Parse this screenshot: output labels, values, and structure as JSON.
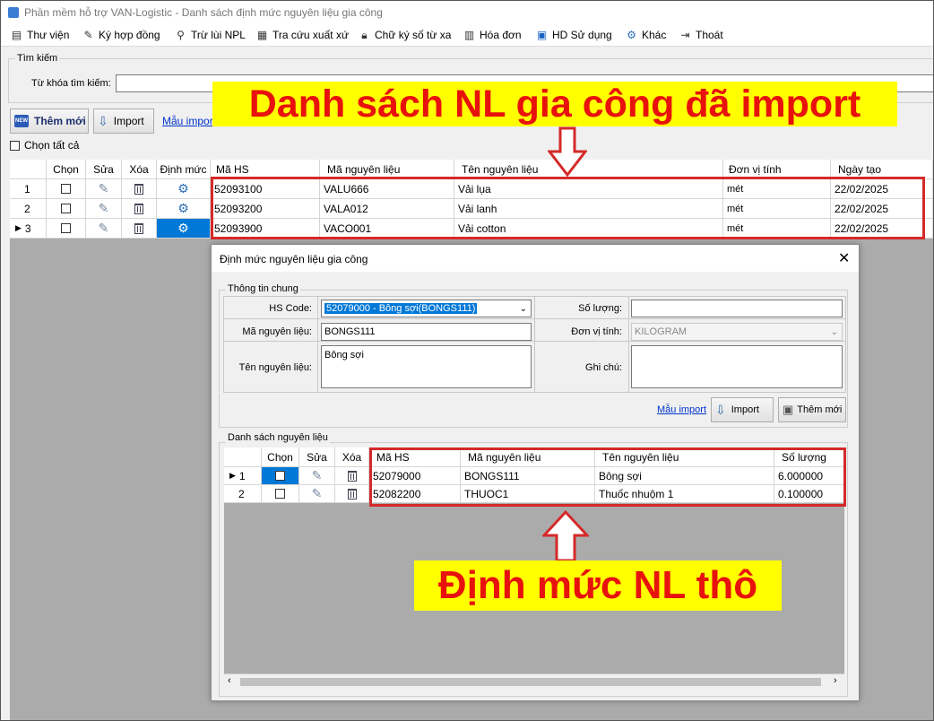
{
  "window": {
    "title": "Phần mềm hỗ trợ VAN-Logistic - Danh sách định mức nguyên liệu gia công"
  },
  "menu": [
    {
      "label": "Thư viện",
      "icon": "library-icon"
    },
    {
      "label": "Ký hợp đồng",
      "icon": "sign-contract-icon"
    },
    {
      "label": "Trừ lùi NPL",
      "icon": "search-deduct-icon"
    },
    {
      "label": "Tra cứu xuất xứ",
      "icon": "origin-lookup-icon"
    },
    {
      "label": "Chữ ký số từ xa",
      "icon": "digital-signature-icon"
    },
    {
      "label": "Hóa đơn",
      "icon": "invoice-icon"
    },
    {
      "label": "HD Sử dụng",
      "icon": "help-icon"
    },
    {
      "label": "Khác",
      "icon": "gear-icon"
    },
    {
      "label": "Thoát",
      "icon": "exit-icon"
    }
  ],
  "search": {
    "group_label": "Tìm kiếm",
    "keyword_label": "Từ khóa tìm kiếm:",
    "keyword_value": ""
  },
  "toolbar": {
    "add_label": "Thêm mới",
    "add_badge": "NEW",
    "import_label": "Import",
    "template_link": "Mẫu import",
    "select_all_label": "Chọn tất cả"
  },
  "main_grid": {
    "columns": [
      "Chọn",
      "Sửa",
      "Xóa",
      "Định mức",
      "Mã HS",
      "Mã nguyên liệu",
      "Tên nguyên liệu",
      "Đơn vị tính",
      "Ngày tạo"
    ],
    "rows": [
      {
        "num": "1",
        "hs": "52093100",
        "code": "VALU666",
        "name": "Vải lụa",
        "unit": "mét",
        "date": "22/02/2025"
      },
      {
        "num": "2",
        "hs": "52093200",
        "code": "VALA012",
        "name": "Vải lanh",
        "unit": "mét",
        "date": "22/02/2025"
      },
      {
        "num": "3",
        "hs": "52093900",
        "code": "VACO001",
        "name": "Vải cotton",
        "unit": "mét",
        "date": "22/02/2025"
      }
    ]
  },
  "dialog": {
    "title": "Định mức nguyên liệu gia công",
    "general_group": "Thông tin chung",
    "hs_code_label": "HS Code:",
    "hs_code_value": "52079000 - Bông sợi(BONGS111)",
    "material_code_label": "Mã nguyên liệu:",
    "material_code_value": "BONGS111",
    "material_name_label": "Tên nguyên liệu:",
    "material_name_value": "Bông sợi",
    "quantity_label": "Số lượng:",
    "quantity_value": "",
    "unit_label": "Đơn vị tính:",
    "unit_value": "KILOGRAM",
    "note_label": "Ghi chú:",
    "note_value": "",
    "template_link": "Mẫu import",
    "import_label": "Import",
    "add_label": "Thêm mới",
    "list_group": "Danh sách nguyên liệu",
    "columns": [
      "Chọn",
      "Sửa",
      "Xóa",
      "Mã HS",
      "Mã nguyên liệu",
      "Tên nguyên liệu",
      "Số lượng"
    ],
    "rows": [
      {
        "num": "1",
        "hs": "52079000",
        "code": "BONGS111",
        "name": "Bông sợi",
        "qty": "6.000000"
      },
      {
        "num": "2",
        "hs": "52082200",
        "code": "THUOC1",
        "name": "Thuốc nhuộm 1",
        "qty": "0.100000"
      }
    ]
  },
  "annotations": {
    "top_callout": "Danh sách NL gia công đã import",
    "bottom_callout": "Định mức NL thô"
  },
  "colors": {
    "callout_bg": "#ffff00",
    "callout_text": "#e8120c",
    "highlight_box": "#d42a2a",
    "selection": "#0078d7"
  }
}
